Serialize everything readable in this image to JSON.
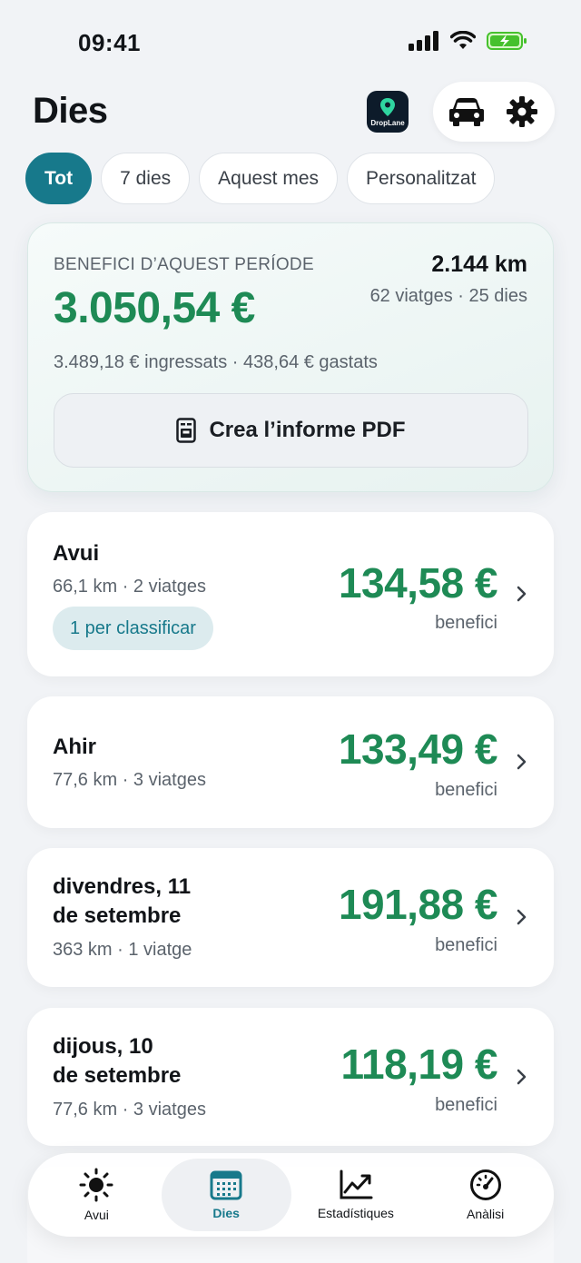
{
  "status_bar": {
    "time": "09:41"
  },
  "header": {
    "title": "Dies",
    "logo_text": "DropLane"
  },
  "filters": [
    {
      "label": "Tot",
      "active": true
    },
    {
      "label": "7 dies",
      "active": false
    },
    {
      "label": "Aquest mes",
      "active": false
    },
    {
      "label": "Personalitzat",
      "active": false
    }
  ],
  "summary": {
    "period_label": "BENEFICI D’AQUEST PERÍODE",
    "profit": "3.050,54 €",
    "km": "2.144 km",
    "trips_days": "62 viatges · 25 dies",
    "breakdown": "3.489,18 € ingressats · 438,64 € gastats",
    "pdf_button": "Crea l’informe PDF"
  },
  "days": [
    {
      "title": "Avui",
      "meta": "66,1 km · 2 viatges",
      "amount": "134,58 €",
      "sub": "benefici",
      "pill": "1 per classificar"
    },
    {
      "title": "Ahir",
      "meta": "77,6 km · 3 viatges",
      "amount": "133,49 €",
      "sub": "benefici"
    },
    {
      "title_line1": "divendres, 11",
      "title_line2": "de setembre",
      "meta": "363 km · 1 viatge",
      "amount": "191,88 €",
      "sub": "benefici"
    },
    {
      "title_line1": "dijous, 10",
      "title_line2": "de setembre",
      "meta": "77,6 km · 3 viatges",
      "amount": "118,19 €",
      "sub": "benefici"
    }
  ],
  "tabs": [
    {
      "label": "Avui",
      "icon": "sun-icon",
      "active": false
    },
    {
      "label": "Dies",
      "icon": "calendar-icon",
      "active": true
    },
    {
      "label": "Estadístiques",
      "icon": "chart-icon",
      "active": false
    },
    {
      "label": "Anàlisi",
      "icon": "gauge-icon",
      "active": false
    }
  ],
  "colors": {
    "accent": "#17798b",
    "profit": "#1e8a55"
  }
}
